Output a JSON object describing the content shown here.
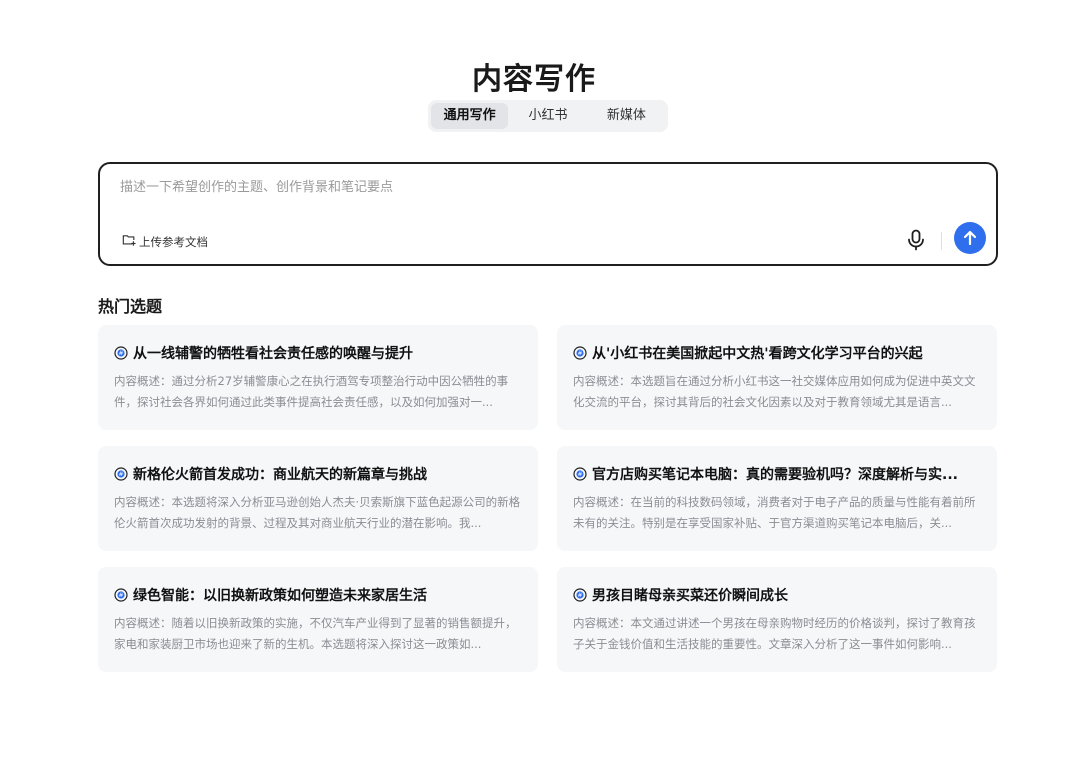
{
  "header": {
    "title": "内容写作"
  },
  "tabs": [
    {
      "label": "通用写作",
      "active": true
    },
    {
      "label": "小红书",
      "active": false
    },
    {
      "label": "新媒体",
      "active": false
    }
  ],
  "composer": {
    "placeholder": "描述一下希望创作的主题、创作背景和笔记要点",
    "value": "",
    "upload_label": "上传参考文档"
  },
  "colors": {
    "accent": "#2f6fed",
    "card_bg": "#f6f7f9"
  },
  "hot_topics": {
    "title": "热门选题",
    "items": [
      {
        "title": "从一线辅警的牺牲看社会责任感的唤醒与提升",
        "desc": "内容概述：通过分析27岁辅警康心之在执行酒驾专项整治行动中因公牺牲的事件，探讨社会各界如何通过此类事件提高社会责任感，以及如何加强对一..."
      },
      {
        "title": "从'小红书在美国掀起中文热'看跨文化学习平台的兴起",
        "desc": "内容概述：本选题旨在通过分析小红书这一社交媒体应用如何成为促进中英文文化交流的平台，探讨其背后的社会文化因素以及对于教育领域尤其是语言..."
      },
      {
        "title": "新格伦火箭首发成功：商业航天的新篇章与挑战",
        "desc": "内容概述：本选题将深入分析亚马逊创始人杰夫·贝索斯旗下蓝色起源公司的新格伦火箭首次成功发射的背景、过程及其对商业航天行业的潜在影响。我..."
      },
      {
        "title": "官方店购买笔记本电脑：真的需要验机吗？深度解析与实...",
        "desc": "内容概述：在当前的科技数码领域，消费者对于电子产品的质量与性能有着前所未有的关注。特别是在享受国家补贴、于官方渠道购买笔记本电脑后，关..."
      },
      {
        "title": "绿色智能：以旧换新政策如何塑造未来家居生活",
        "desc": "内容概述：随着以旧换新政策的实施，不仅汽车产业得到了显著的销售额提升，家电和家装厨卫市场也迎来了新的生机。本选题将深入探讨这一政策如..."
      },
      {
        "title": "男孩目睹母亲买菜还价瞬间成长",
        "desc": "内容概述：本文通过讲述一个男孩在母亲购物时经历的价格谈判，探讨了教育孩子关于金钱价值和生活技能的重要性。文章深入分析了这一事件如何影响..."
      }
    ]
  }
}
